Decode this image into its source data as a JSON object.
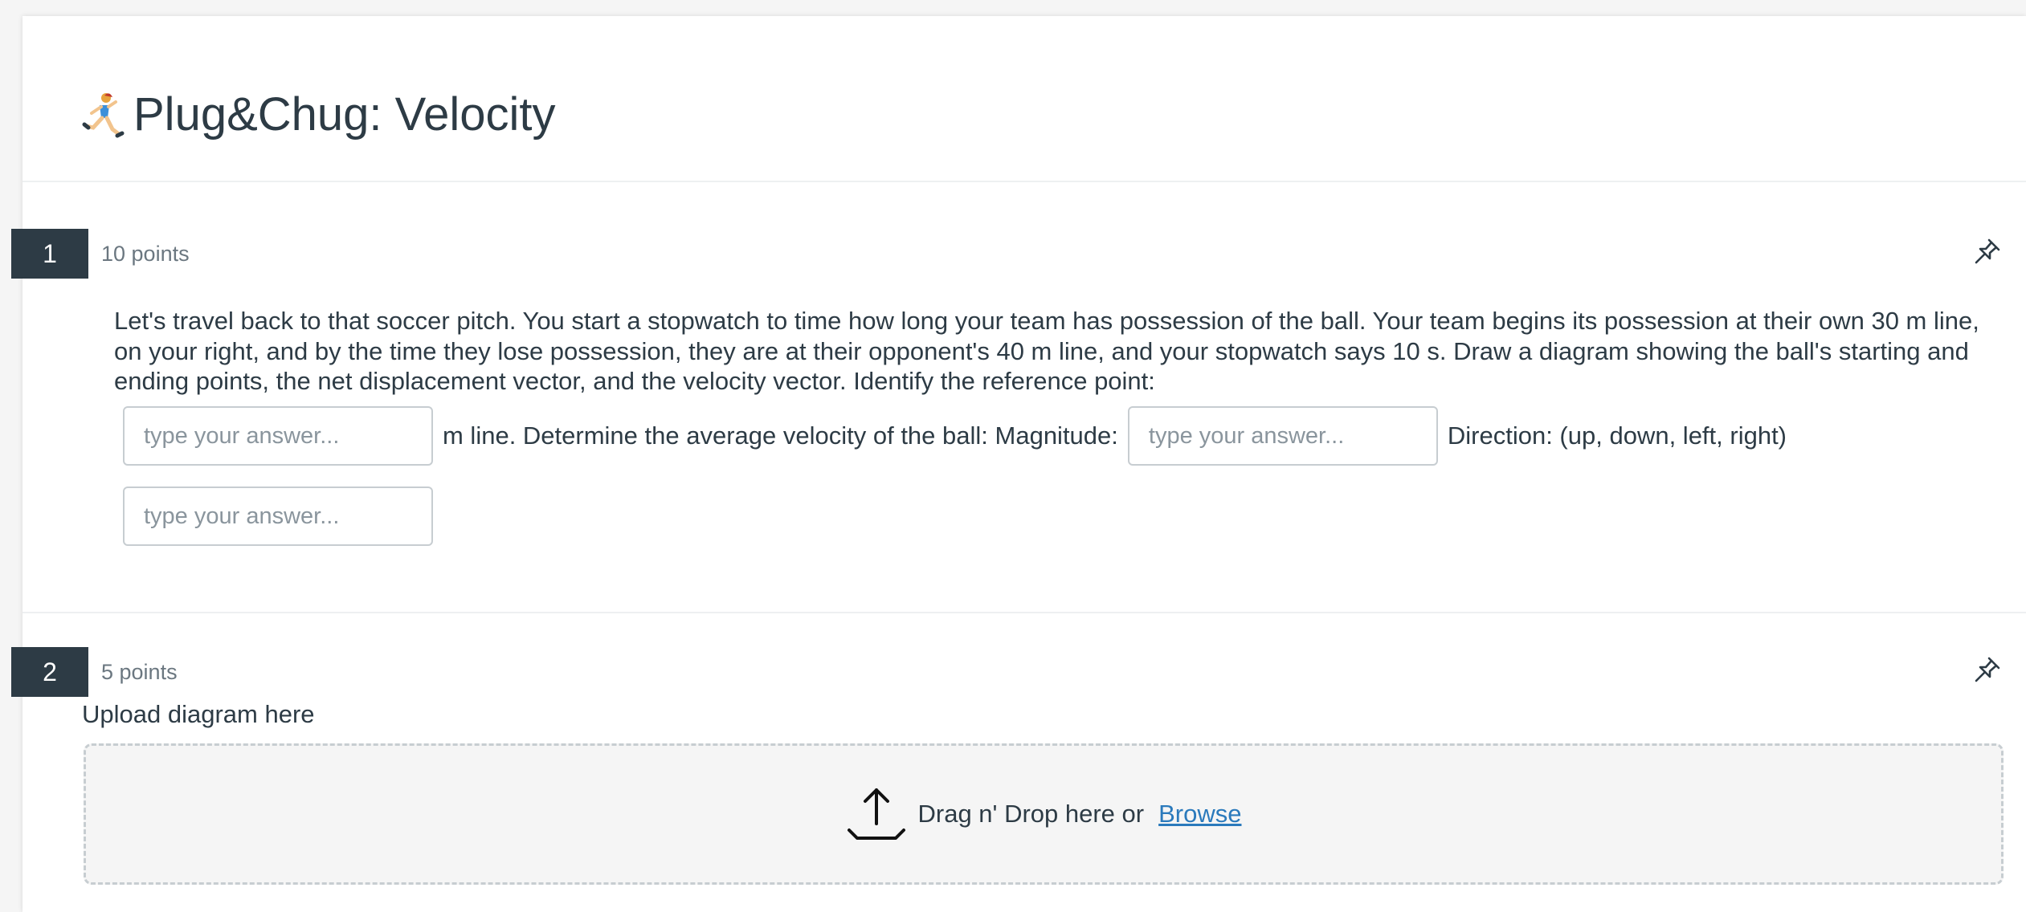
{
  "quiz": {
    "title": "Plug&Chug: Velocity",
    "title_icon": "runner-icon"
  },
  "questions": [
    {
      "number": "1",
      "points": "10 points",
      "pin_icon": "pin-icon",
      "text": "Let's travel back to that soccer pitch. You start a stopwatch to time how long your team has possession of the ball. Your team begins its possession at their own 30 m line, on your right, and by the time they lose possession, they are at their opponent's 40 m line, and your stopwatch says 10 s. Draw a diagram showing the ball's starting and ending points, the net displacement vector, and the velocity vector. Identify the reference point:",
      "blank1_placeholder": "type your answer...",
      "after_blank1": "m line. Determine the average velocity of the ball: Magnitude:",
      "blank2_placeholder": "type your answer...",
      "after_blank2": "Direction: (up, down, left, right)",
      "blank3_placeholder": "type your answer..."
    },
    {
      "number": "2",
      "points": "5 points",
      "pin_icon": "pin-icon",
      "upload_label": "Upload diagram here",
      "dropzone_text": "Drag n' Drop here or",
      "browse_label": "Browse",
      "upload_icon": "upload-icon"
    }
  ],
  "colors": {
    "number_badge": "#2d3b45",
    "link": "#2b7abc",
    "text": "#2d3b45",
    "muted": "#6b7780"
  }
}
